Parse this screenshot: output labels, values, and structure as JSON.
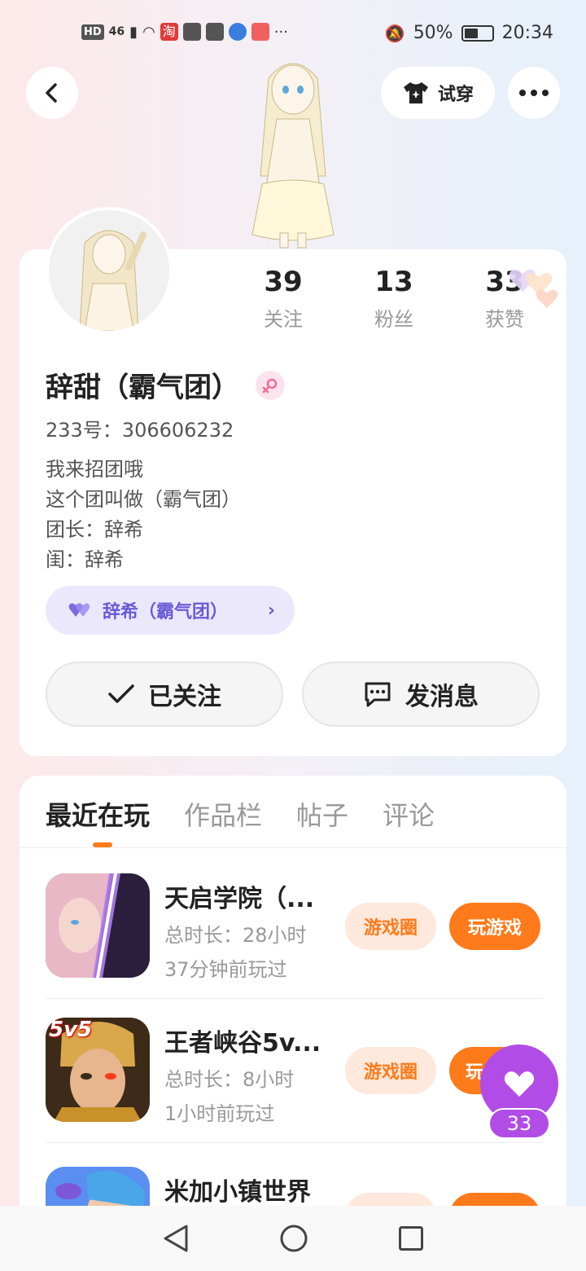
{
  "status_bar": {
    "hd": "HD",
    "network": "46",
    "taobao": "淘",
    "battery": "50%",
    "time": "20:34",
    "more": "···"
  },
  "header": {
    "try_on_label": "试穿"
  },
  "profile": {
    "stats": [
      {
        "num": "39",
        "label": "关注"
      },
      {
        "num": "13",
        "label": "粉丝"
      },
      {
        "num": "33",
        "label": "获赞"
      }
    ],
    "name": "辞甜（霸气团）",
    "uid": "233号：306606232",
    "bio": [
      "我来招团哦",
      "这个团叫做（霸气团）",
      "团长：辞希",
      "闺：辞希"
    ],
    "group_pill": "辞希（霸气团）",
    "follow_label": "已关注",
    "message_label": "发消息"
  },
  "tabs": [
    "最近在玩",
    "作品栏",
    "帖子",
    "评论"
  ],
  "games": [
    {
      "title": "天启学院（...",
      "duration": "总时长：28小时",
      "last_played": "37分钟前玩过",
      "circle_label": "游戏圈",
      "play_label": "玩游戏"
    },
    {
      "title": "王者峡谷5v...",
      "duration": "总时长：8小时",
      "last_played": "1小时前玩过",
      "circle_label": "游戏圈",
      "play_label": "玩"
    },
    {
      "title": "米加小镇世界"
    }
  ],
  "game2_badge": "5v5",
  "like_count": "33",
  "colors": {
    "accent_orange": "#ff7a1a",
    "purple": "#b14de6",
    "group_purple": "#6a5bd6"
  }
}
